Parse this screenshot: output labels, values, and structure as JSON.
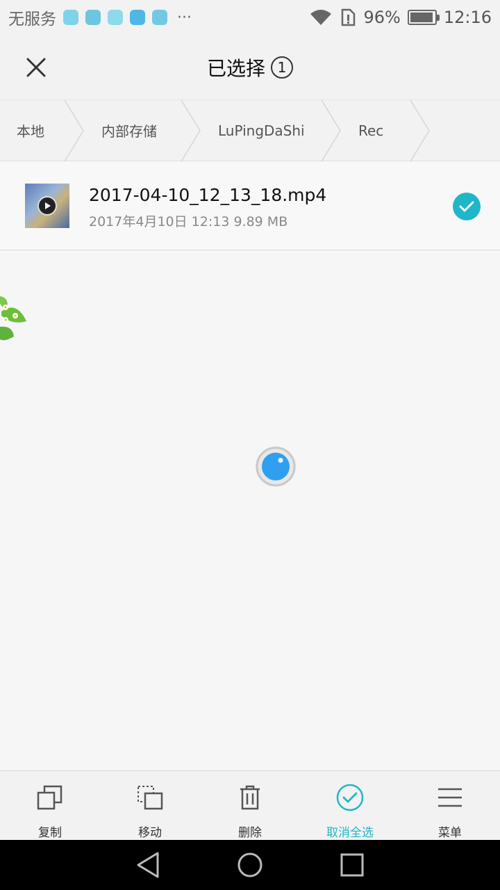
{
  "status_bar": {
    "carrier": "无服务",
    "battery_text": "96%",
    "battery_level": 0.96,
    "time": "12:16",
    "app_icons": [
      "app-icon-1",
      "app-icon-2",
      "mi-icon",
      "app-icon-4",
      "app-icon-5"
    ],
    "more": "···"
  },
  "header": {
    "title": "已选择",
    "count": "1"
  },
  "breadcrumb": {
    "items": [
      "本地",
      "内部存储",
      "LuPingDaShi",
      "Rec"
    ]
  },
  "files": [
    {
      "name": "2017-04-10_12_13_18.mp4",
      "meta": "2017年4月10日 12:13 9.89 MB",
      "selected": true
    }
  ],
  "toolbar": {
    "copy": "复制",
    "move": "移动",
    "delete": "删除",
    "deselect_all": "取消全选",
    "menu": "菜单"
  },
  "colors": {
    "accent": "#1fb6c9",
    "loader_blue": "#2f9ff0",
    "background": "#f6f6f6"
  }
}
